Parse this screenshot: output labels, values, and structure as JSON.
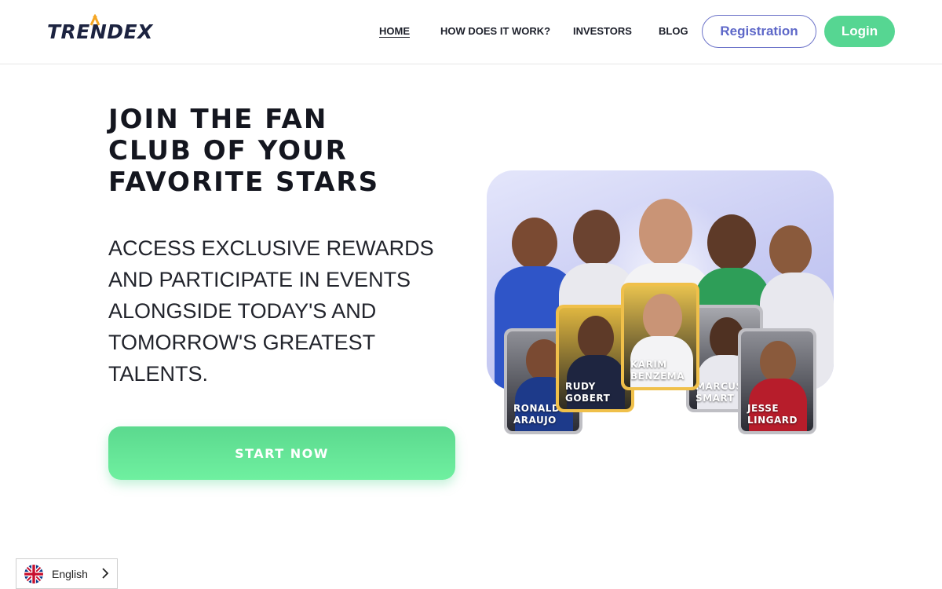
{
  "brand": {
    "logo_text": "TRENDEX",
    "accent": "#56d692",
    "secondary": "#5d67c8",
    "dark": "#14161f"
  },
  "nav": {
    "items": [
      {
        "label": "HOME",
        "active": true
      },
      {
        "label": "HOW DOES IT WORK?",
        "active": false
      },
      {
        "label": "INVESTORS",
        "active": false
      },
      {
        "label": "BLOG",
        "active": false
      }
    ],
    "registration_label": "Registration",
    "login_label": "Login"
  },
  "hero": {
    "title_lines": [
      "JOIN THE FAN",
      "CLUB OF YOUR",
      "FAVORITE STARS"
    ],
    "subtitle_lines": [
      "ACCESS EXCLUSIVE REWARDS",
      "AND PARTICIPATE IN EVENTS",
      "ALONGSIDE TODAY'S AND",
      "TOMORROW'S GREATEST",
      "TALENTS."
    ],
    "cta_label": "START NOW"
  },
  "cards": [
    {
      "name_lines": [
        "RONALD",
        "ARAUJO"
      ],
      "tier": "silver"
    },
    {
      "name_lines": [
        "RUDY",
        "GOBERT"
      ],
      "tier": "gold"
    },
    {
      "name_lines": [
        "KARIM",
        "BENZEMA"
      ],
      "tier": "gold"
    },
    {
      "name_lines": [
        "MARCUS",
        "SMART"
      ],
      "tier": "silver"
    },
    {
      "name_lines": [
        "JESSE",
        "LINGARD"
      ],
      "tier": "silver"
    }
  ],
  "language": {
    "label": "English",
    "icon": "uk-flag-icon"
  }
}
